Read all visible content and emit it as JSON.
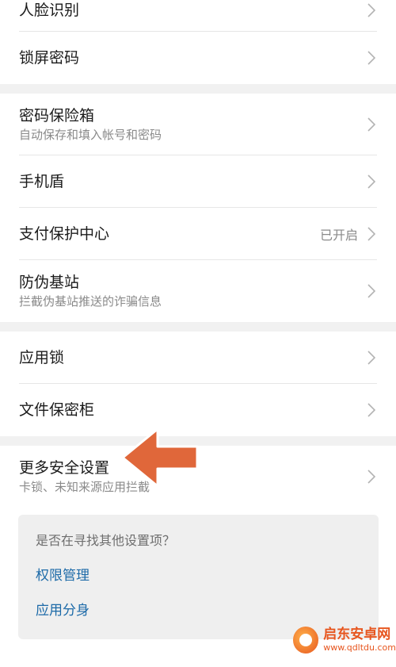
{
  "group1": {
    "items": [
      {
        "title": "人脸识别"
      },
      {
        "title": "锁屏密码"
      }
    ]
  },
  "group2": {
    "items": [
      {
        "title": "密码保险箱",
        "subtitle": "自动保存和填入帐号和密码"
      },
      {
        "title": "手机盾"
      },
      {
        "title": "支付保护中心",
        "value": "已开启"
      },
      {
        "title": "防伪基站",
        "subtitle": "拦截伪基站推送的诈骗信息"
      }
    ]
  },
  "group3": {
    "items": [
      {
        "title": "应用锁"
      },
      {
        "title": "文件保密柜"
      }
    ]
  },
  "group4": {
    "items": [
      {
        "title": "更多安全设置",
        "subtitle": "卡锁、未知来源应用拦截"
      }
    ]
  },
  "suggest": {
    "question": "是否在寻找其他设置项？",
    "links": [
      "权限管理",
      "应用分身"
    ]
  },
  "watermark": {
    "name": "启东安卓网",
    "url": "www.qdltdu.com"
  },
  "colors": {
    "link": "#1c6aa8",
    "arrow": "#e0673a",
    "separator": "#f1f1f1"
  },
  "icons": {
    "chevron": "chevron-right-icon",
    "annotation": "arrow-left-icon"
  }
}
